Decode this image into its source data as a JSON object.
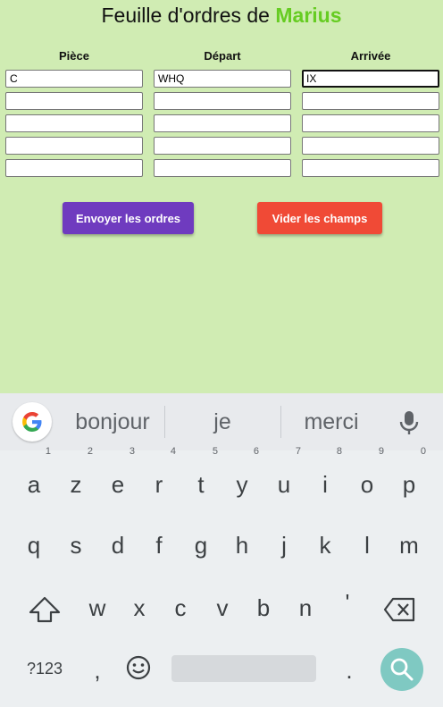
{
  "header": {
    "title_prefix": "Feuille d'ordres de",
    "player_name": "Marius"
  },
  "table": {
    "columns": [
      "Pièce",
      "Départ",
      "Arrivée"
    ],
    "rows": [
      [
        "C",
        "WHQ",
        "IX"
      ],
      [
        "",
        "",
        ""
      ],
      [
        "",
        "",
        ""
      ],
      [
        "",
        "",
        ""
      ],
      [
        "",
        "",
        ""
      ]
    ]
  },
  "buttons": {
    "send_label": "Envoyer les ordres",
    "clear_label": "Vider les champs"
  },
  "keyboard": {
    "suggestions": [
      "bonjour",
      "je",
      "merci"
    ],
    "row1": [
      "a",
      "z",
      "e",
      "r",
      "t",
      "y",
      "u",
      "i",
      "o",
      "p"
    ],
    "row1_hints": [
      "1",
      "2",
      "3",
      "4",
      "5",
      "6",
      "7",
      "8",
      "9",
      "0"
    ],
    "row2": [
      "q",
      "s",
      "d",
      "f",
      "g",
      "h",
      "j",
      "k",
      "l",
      "m"
    ],
    "row3": [
      "w",
      "x",
      "c",
      "v",
      "b",
      "n",
      "'"
    ],
    "symbols_label": "?123",
    "comma": ",",
    "period": "."
  },
  "colors": {
    "background": "#d0ecb3",
    "name_accent": "#66cc22",
    "send_button": "#6f3bbf",
    "clear_button": "#f04a36",
    "search_key": "#7fc9c2"
  }
}
